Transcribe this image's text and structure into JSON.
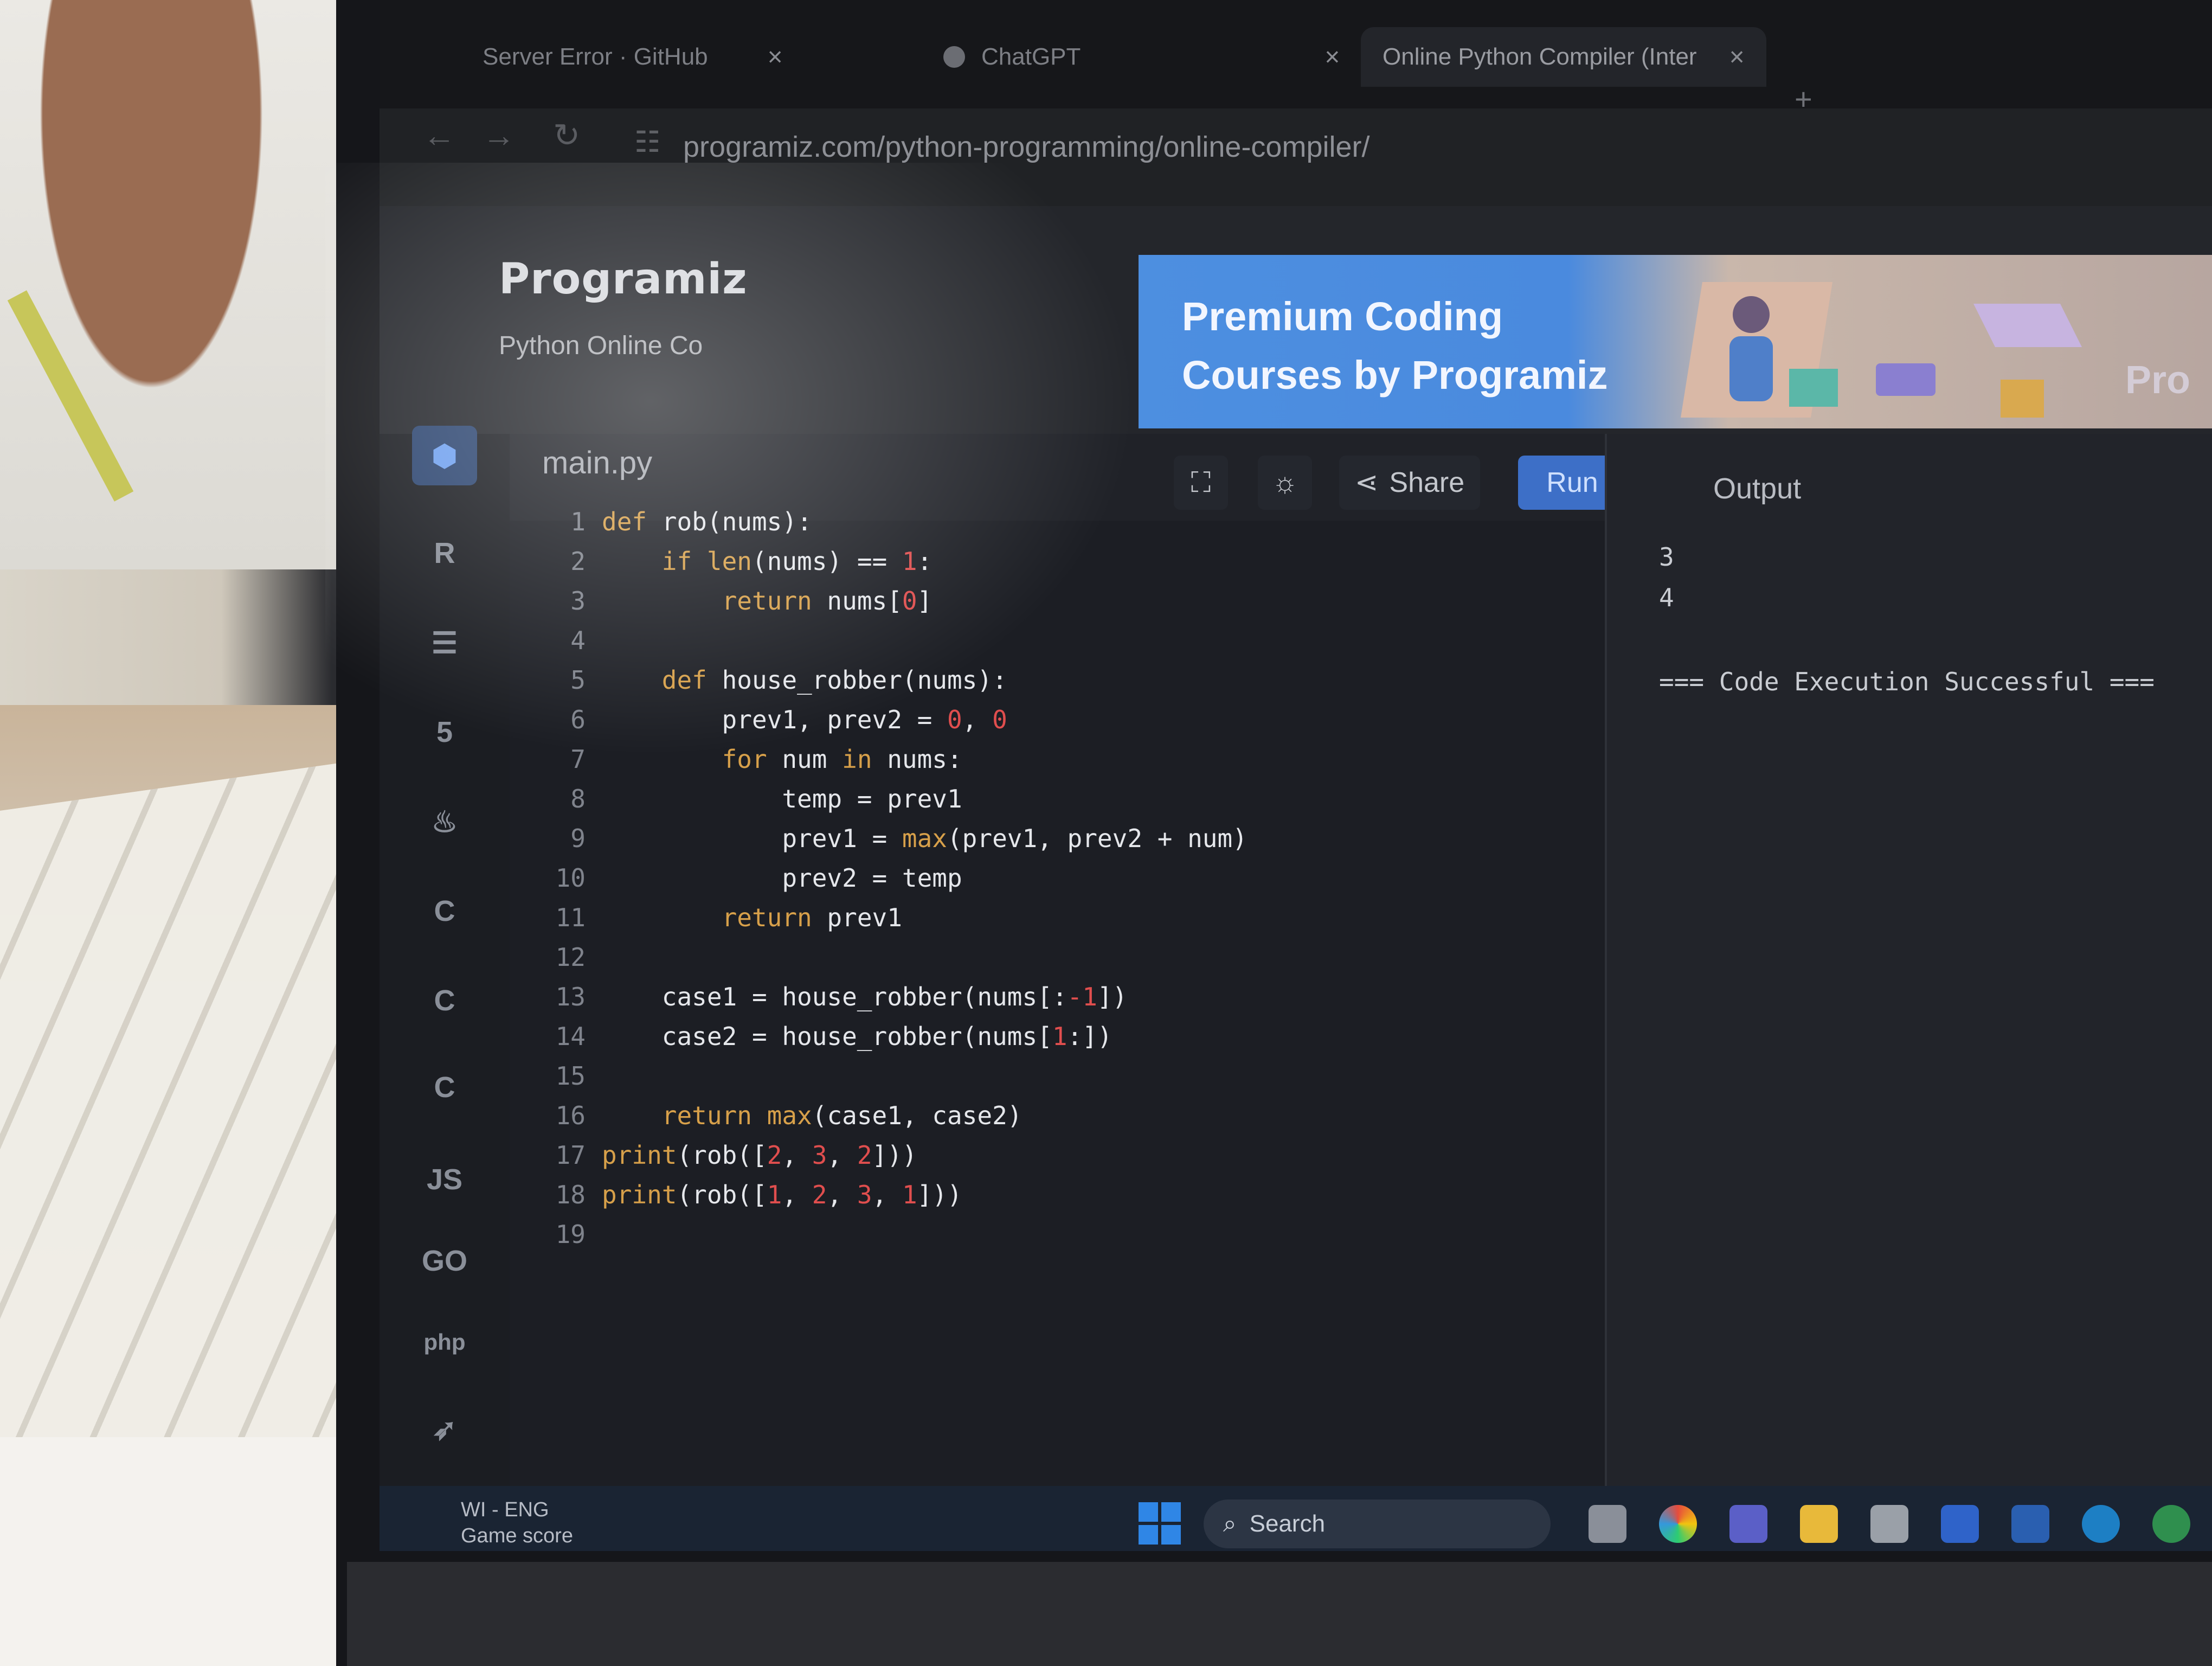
{
  "browser": {
    "tabs": [
      {
        "label": "Server Error · GitHub"
      },
      {
        "label": "ChatGPT"
      },
      {
        "label": "Online Python Compiler (Inter"
      }
    ],
    "tab_close": "×",
    "new_tab": "+",
    "url": "programiz.com/python-programming/online-compiler/"
  },
  "header": {
    "logo": "Programiz",
    "subtitle": "Python Online Co",
    "banner_line1": "Premium Coding",
    "banner_line2": "Courses by Programiz",
    "banner_tag": "Pro"
  },
  "sidebar": {
    "items": [
      {
        "label": "",
        "icon": "python-icon"
      },
      {
        "label": "R",
        "icon": "r-icon"
      },
      {
        "label": "",
        "icon": "database-icon"
      },
      {
        "label": "5",
        "icon": "html5-icon"
      },
      {
        "label": "",
        "icon": "java-icon"
      },
      {
        "label": "C",
        "icon": "c-icon"
      },
      {
        "label": "C",
        "icon": "cpp-icon"
      },
      {
        "label": "C",
        "icon": "csharp-icon"
      },
      {
        "label": "JS",
        "icon": "javascript-icon"
      },
      {
        "label": "GO",
        "icon": "go-icon"
      },
      {
        "label": "php",
        "icon": "php-icon"
      },
      {
        "label": "",
        "icon": "swift-icon"
      }
    ]
  },
  "editor": {
    "filename": "main.py",
    "share_label": "Share",
    "run_label": "Run",
    "lines": [
      "def rob(nums):",
      "    if len(nums) == 1:",
      "        return nums[0]",
      "",
      "    def house_robber(nums):",
      "        prev1, prev2 = 0, 0",
      "        for num in nums:",
      "            temp = prev1",
      "            prev1 = max(prev1, prev2 + num)",
      "            prev2 = temp",
      "        return prev1",
      "",
      "    case1 = house_robber(nums[:-1])",
      "    case2 = house_robber(nums[1:])",
      "",
      "    return max(case1, case2)",
      "print(rob([2, 3, 2]))",
      "print(rob([1, 2, 3, 1]))",
      ""
    ]
  },
  "output": {
    "title": "Output",
    "lines": [
      "3",
      "4",
      "",
      "=== Code Execution Successful ==="
    ]
  },
  "taskbar": {
    "weather_line1": "WI - ENG",
    "weather_line2": "Game score",
    "search_label": "Search"
  },
  "colors": {
    "accent": "#3d6fc7",
    "banner_blue": "#4d8fe0",
    "keyword": "#d7a04a",
    "number": "#e04e4e"
  }
}
